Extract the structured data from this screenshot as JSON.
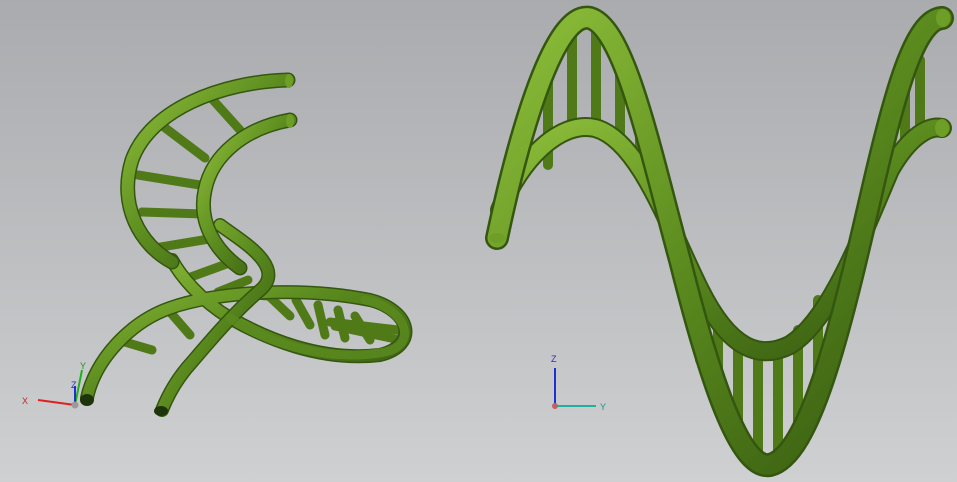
{
  "viewport": {
    "background_top": "#a9abae",
    "background_bottom": "#cfd0d2"
  },
  "model": {
    "color": "#5a8a1e",
    "highlight": "#8fbf3a",
    "shadow": "#2f4d0c"
  },
  "left_triad": {
    "x_label": "X",
    "y_label": "Y",
    "z_label": "Z",
    "x_color": "#e02020",
    "y_color": "#20b020",
    "z_color": "#2030d0"
  },
  "right_triad": {
    "y_label": "Y",
    "z_label": "Z",
    "x_color": "#e02020",
    "y_color": "#20b0a0",
    "z_color": "#2030d0"
  }
}
